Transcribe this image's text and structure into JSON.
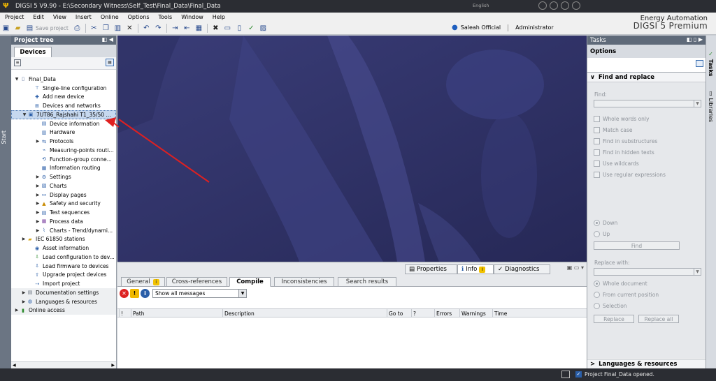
{
  "window": {
    "title": "DIGSI 5 V9.90  -  E:\\Secondary Witness\\Self_Test\\Final_Data\\Final_Data",
    "lang_text": "English"
  },
  "menu": [
    "Project",
    "Edit",
    "View",
    "Insert",
    "Online",
    "Options",
    "Tools",
    "Window",
    "Help"
  ],
  "toolbar": {
    "save_label": "Save project"
  },
  "user": {
    "name": "Saleah Official",
    "role": "Administrator"
  },
  "brand": {
    "line1": "Energy Automation",
    "line2": "DIGSI 5 Premium"
  },
  "start_label": "Start",
  "project_tree": {
    "title": "Project tree",
    "tab": "Devices",
    "items": [
      {
        "label": "Final_Data",
        "indent": 0,
        "arrow": "down",
        "icon": "project"
      },
      {
        "label": "Single-line configuration",
        "indent": 2,
        "arrow": "",
        "icon": "sld"
      },
      {
        "label": "Add new device",
        "indent": 2,
        "arrow": "",
        "icon": "add"
      },
      {
        "label": "Devices and networks",
        "indent": 2,
        "arrow": "",
        "icon": "net"
      },
      {
        "label": "7UT86_Rajshahi T1_35/50 ...",
        "indent": 1,
        "arrow": "down",
        "icon": "device",
        "selected": true
      },
      {
        "label": "Device information",
        "indent": 3,
        "arrow": "",
        "icon": "info"
      },
      {
        "label": "Hardware",
        "indent": 3,
        "arrow": "",
        "icon": "hw"
      },
      {
        "label": "Protocols",
        "indent": 3,
        "arrow": "right",
        "icon": "proto"
      },
      {
        "label": "Measuring-points routi...",
        "indent": 3,
        "arrow": "",
        "icon": "meas"
      },
      {
        "label": "Function-group conne...",
        "indent": 3,
        "arrow": "",
        "icon": "fg"
      },
      {
        "label": "Information routing",
        "indent": 3,
        "arrow": "",
        "icon": "route"
      },
      {
        "label": "Settings",
        "indent": 3,
        "arrow": "right",
        "icon": "settings"
      },
      {
        "label": "Charts",
        "indent": 3,
        "arrow": "right",
        "icon": "chart"
      },
      {
        "label": "Display pages",
        "indent": 3,
        "arrow": "right",
        "icon": "display"
      },
      {
        "label": "Safety and security",
        "indent": 3,
        "arrow": "right",
        "icon": "lock"
      },
      {
        "label": "Test sequences",
        "indent": 3,
        "arrow": "right",
        "icon": "test"
      },
      {
        "label": "Process data",
        "indent": 3,
        "arrow": "right",
        "icon": "data"
      },
      {
        "label": "Charts - Trend/dynami...",
        "indent": 3,
        "arrow": "right",
        "icon": "trend"
      },
      {
        "label": "IEC 61850 stations",
        "indent": 1,
        "arrow": "right",
        "icon": "folder"
      },
      {
        "label": "Asset information",
        "indent": 2,
        "arrow": "",
        "icon": "asset"
      },
      {
        "label": "Load configuration to dev...",
        "indent": 2,
        "arrow": "",
        "icon": "load"
      },
      {
        "label": "Load firmware to devices",
        "indent": 2,
        "arrow": "",
        "icon": "fw"
      },
      {
        "label": "Upgrade project devices",
        "indent": 2,
        "arrow": "",
        "icon": "upgrade"
      },
      {
        "label": "Import project",
        "indent": 2,
        "arrow": "",
        "icon": "import"
      },
      {
        "label": "Documentation settings",
        "indent": 1,
        "arrow": "right",
        "icon": "doc",
        "shaded": true
      },
      {
        "label": "Languages & resources",
        "indent": 1,
        "arrow": "right",
        "icon": "lang",
        "shaded": true
      },
      {
        "label": "Online access",
        "indent": 0,
        "arrow": "right",
        "icon": "online",
        "shaded": true
      }
    ]
  },
  "inspector": {
    "tabs": [
      "Properties",
      "Info",
      "Diagnostics"
    ],
    "info_icon": "i",
    "subtabs": [
      "General",
      "Cross-references",
      "Compile",
      "Inconsistencies",
      "Search results"
    ],
    "active_subtab": "Compile",
    "filter": {
      "selected": "Show all messages"
    },
    "columns": [
      "!",
      "Path",
      "Description",
      "Go to",
      "?",
      "Errors",
      "Warnings",
      "Time"
    ]
  },
  "tasks": {
    "title": "Tasks",
    "options": "Options",
    "find_replace": {
      "title": "Find and replace",
      "find_label": "Find:",
      "checkboxes": [
        "Whole words only",
        "Match case",
        "Find in substructures",
        "Find in hidden texts",
        "Use wildcards",
        "Use regular expressions"
      ],
      "direction": [
        "Down",
        "Up"
      ],
      "find_button": "Find",
      "replace_label": "Replace with:",
      "scope": [
        "Whole document",
        "From current position",
        "Selection"
      ],
      "replace_button": "Replace",
      "replace_all_button": "Replace all"
    },
    "footer": "Languages & resources"
  },
  "side_tabs": [
    "Tasks",
    "Libraries"
  ],
  "status": {
    "message": "Project Final_Data opened."
  },
  "colors": {
    "workarea_bg": "#303164",
    "annotation_arrow": "#e02020",
    "header_bg": "#5f6a79"
  }
}
